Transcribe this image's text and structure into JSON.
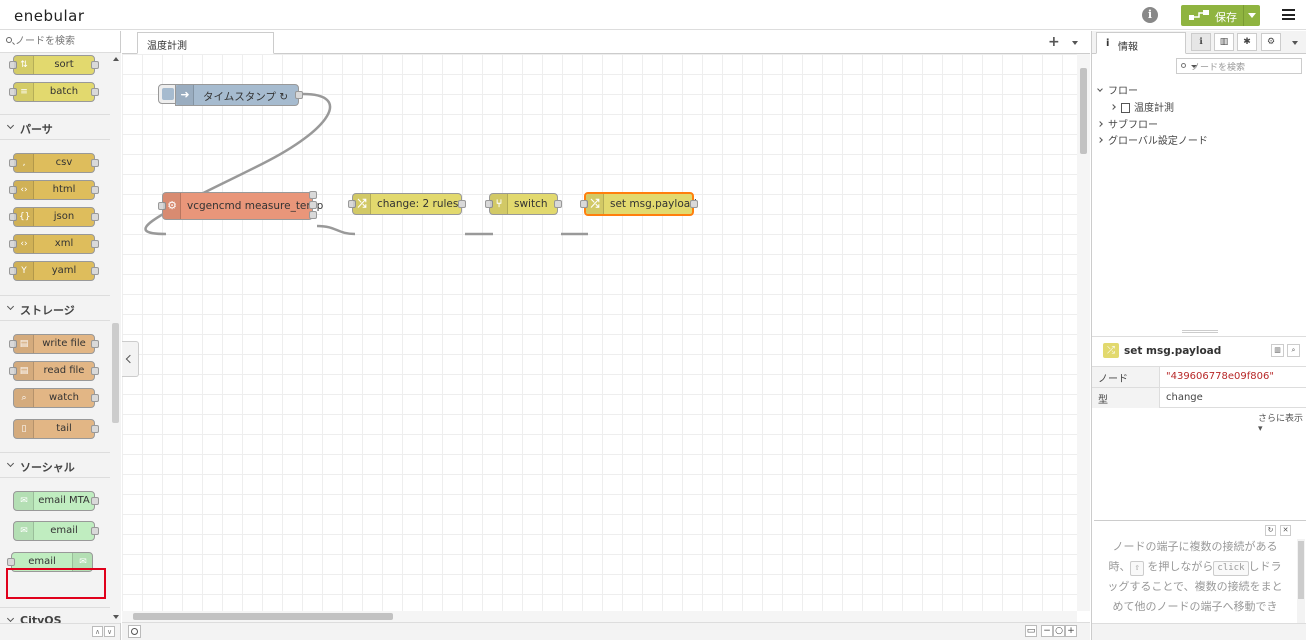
{
  "header": {
    "logo": "enebular",
    "deploy_label": "保存"
  },
  "palette": {
    "search_placeholder": "ノードを検索",
    "categories": [
      "パーサ",
      "ストレージ",
      "ソーシャル",
      "CityOS"
    ],
    "nodes": {
      "sort": "sort",
      "batch": "batch",
      "csv": "csv",
      "html": "html",
      "json": "json",
      "xml": "xml",
      "yaml": "yaml",
      "write_file": "write file",
      "read_file": "read file",
      "watch": "watch",
      "tail": "tail",
      "email_mta": "email MTA",
      "email_in": "email",
      "email_out": "email"
    },
    "footer": {
      "up": "∧",
      "down": "∨"
    }
  },
  "workspace": {
    "tab": "温度計測",
    "add": "+",
    "nodes": {
      "inject": "タイムスタンプ ↻",
      "exec": "vcgencmd measure_temp",
      "change1": "change: 2 rules",
      "switch": "switch",
      "change2": "set msg.payload"
    },
    "footer": {
      "zoom_out": "−",
      "zoom_reset": "○",
      "zoom_in": "+"
    }
  },
  "sidebar": {
    "tab_label": "情報",
    "tab_icon": "i",
    "search_placeholder": "ノードを検索",
    "tree": {
      "flows": "フロー",
      "flow_name": "温度計測",
      "subflows": "サブフロー",
      "global": "グローバル設定ノード"
    },
    "node": {
      "title": "set msg.payload",
      "props": [
        {
          "key": "ノード",
          "value": "\"439606778e09f806\""
        },
        {
          "key": "型",
          "value": "change"
        }
      ],
      "more": "さらに表示 ▾"
    },
    "help": {
      "t1": "ノードの端子に複数の接続がある時、",
      "k1": "⇧",
      "t2": "を押しながら",
      "k2": "click",
      "t3": "しドラッグすることで、複数の接続をまとめて他のノードの端子へ移動でき"
    }
  },
  "colors": {
    "deploy": "#8fb440",
    "inject": "#a6bbcf",
    "exec": "#e9967a",
    "function": "#e2d96e",
    "parser": "#debd5c",
    "storage": "#e2b685",
    "social": "#c0edc0",
    "highlight": "#e0001b",
    "selected": "#ff7f0e"
  }
}
